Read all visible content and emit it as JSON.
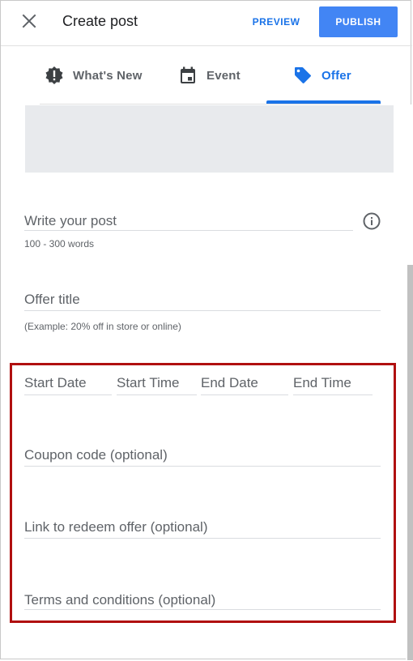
{
  "header": {
    "title": "Create post",
    "preview_label": "PREVIEW",
    "publish_label": "PUBLISH",
    "close_icon": "close-icon"
  },
  "tabs": [
    {
      "label": "What's New",
      "icon": "alert-badge-icon",
      "active": false
    },
    {
      "label": "Event",
      "icon": "calendar-icon",
      "active": false
    },
    {
      "label": "Offer",
      "icon": "tag-icon",
      "active": true
    }
  ],
  "form": {
    "post": {
      "placeholder": "Write your post",
      "helper": "100 - 300 words"
    },
    "offer_title": {
      "placeholder": "Offer title",
      "helper": "(Example: 20% off in store or online)"
    },
    "start_date": {
      "placeholder": "Start Date"
    },
    "start_time": {
      "placeholder": "Start Time"
    },
    "end_date": {
      "placeholder": "End Date"
    },
    "end_time": {
      "placeholder": "End Time"
    },
    "coupon": {
      "placeholder": "Coupon code (optional)"
    },
    "link": {
      "placeholder": "Link to redeem offer (optional)"
    },
    "terms": {
      "placeholder": "Terms and conditions (optional)"
    }
  },
  "colors": {
    "accent": "#1a73e8",
    "publish_bg": "#4285f4",
    "highlight": "#b00f0f",
    "placeholder_bg": "#e8eaed"
  }
}
